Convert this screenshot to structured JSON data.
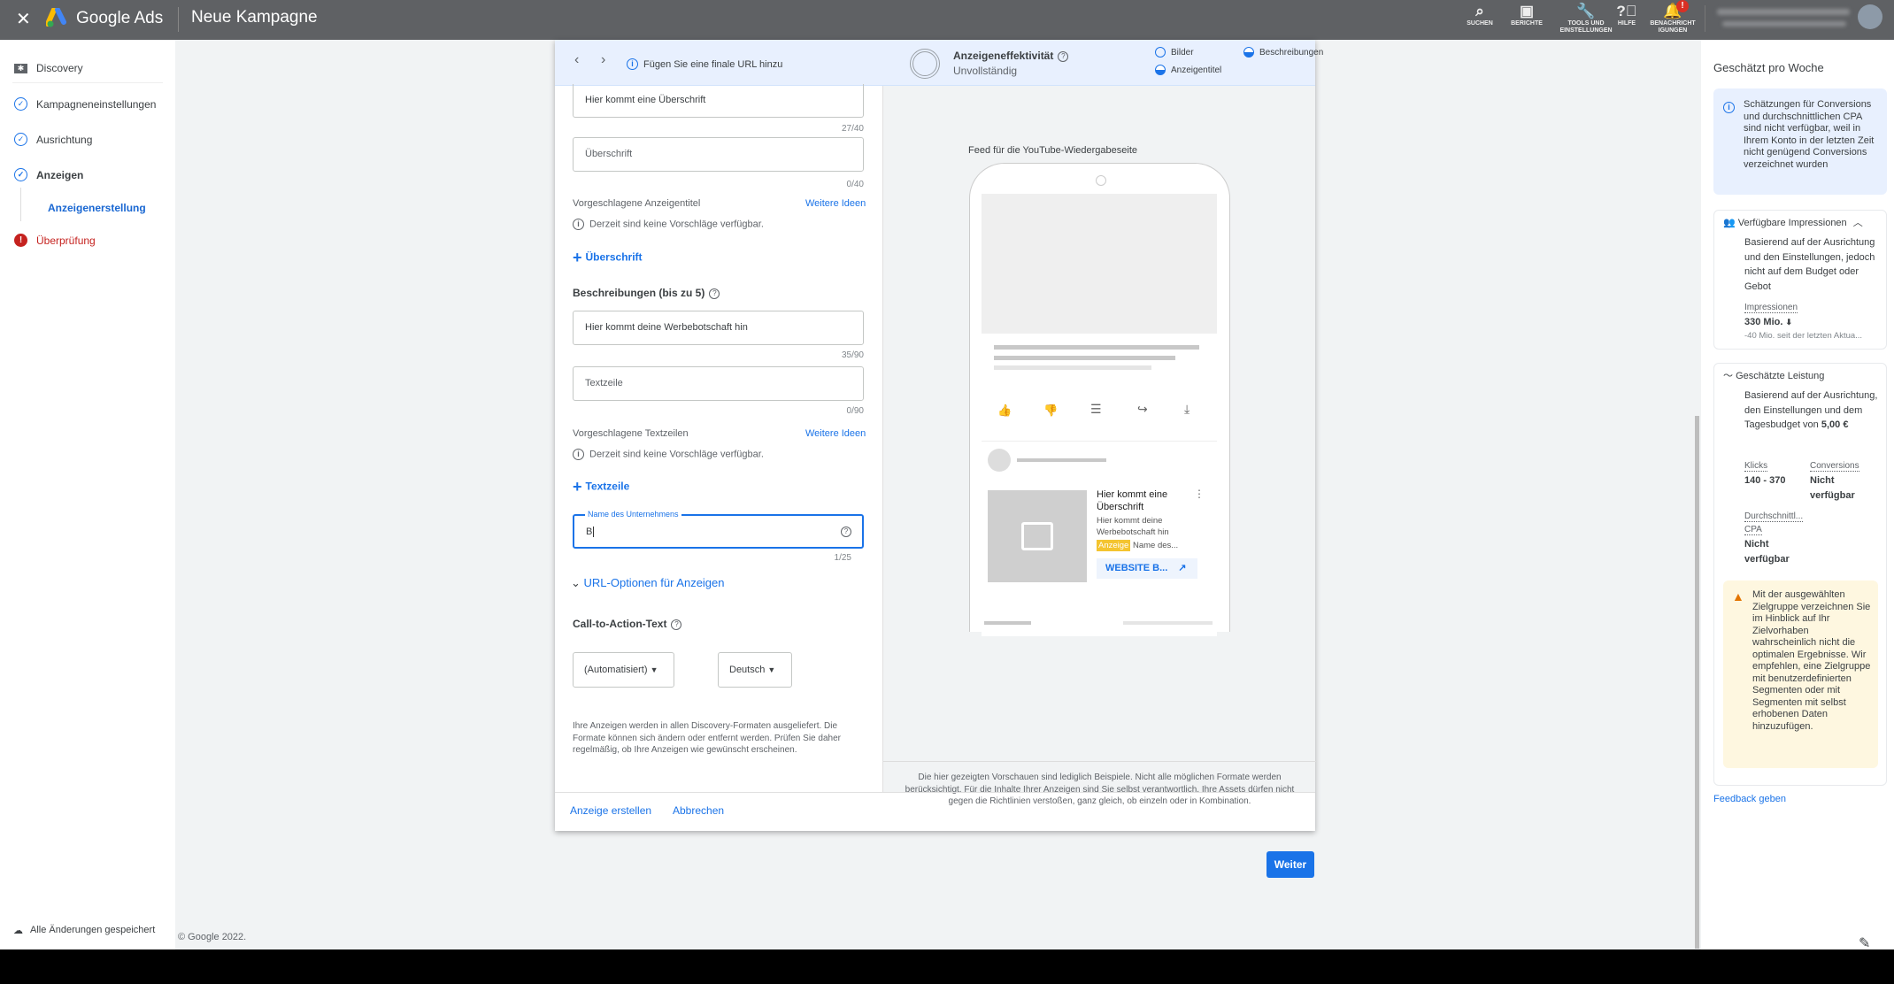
{
  "topbar": {
    "close_icon": "close-icon",
    "product": "Google Ads",
    "title": "Neue Kampagne",
    "actions": [
      {
        "icon": "search-icon",
        "label": "SUCHEN"
      },
      {
        "icon": "reports-icon",
        "label": "BERICHTE"
      },
      {
        "icon": "wrench-icon",
        "label": "TOOLS UND EINSTELLUNGEN"
      },
      {
        "icon": "help-icon",
        "label": "HILFE"
      },
      {
        "icon": "bell-icon",
        "label": "BENACHRICHT IGUNGEN",
        "badge": "!"
      }
    ]
  },
  "sidebar": {
    "campaign_type": "Discovery",
    "items": [
      {
        "label": "Kampagneneinstellungen",
        "state": "done"
      },
      {
        "label": "Ausrichtung",
        "state": "done"
      },
      {
        "label": "Anzeigen",
        "state": "done"
      },
      {
        "label": "Anzeigenerstellung",
        "state": "active"
      },
      {
        "label": "Überprüfung",
        "state": "error"
      }
    ],
    "saved": "Alle Änderungen gespeichert"
  },
  "footer": {
    "copyright": "© Google 2022."
  },
  "dialog": {
    "header": {
      "url_hint": "Fügen Sie eine finale URL hinzu",
      "effectiveness_label": "Anzeigeneffektivität",
      "effectiveness_value": "Unvollständig",
      "assets": [
        "Bilder",
        "Beschreibungen",
        "Anzeigentitel"
      ]
    },
    "headlines": [
      {
        "value": "Hier kommt eine Überschrift",
        "counter": "27/40"
      },
      {
        "placeholder": "Überschrift",
        "counter": "0/40"
      }
    ],
    "suggested_headlines": {
      "label": "Vorgeschlagene Anzeigentitel",
      "more": "Weitere Ideen",
      "empty": "Derzeit sind keine Vorschläge verfügbar."
    },
    "add_headline": "Überschrift",
    "descriptions_title": "Beschreibungen (bis zu 5)",
    "descriptions": [
      {
        "value": "Hier kommt deine Werbebotschaft hin",
        "counter": "35/90"
      },
      {
        "placeholder": "Textzeile",
        "counter": "0/90"
      }
    ],
    "suggested_descriptions": {
      "label": "Vorgeschlagene Textzeilen",
      "more": "Weitere Ideen",
      "empty": "Derzeit sind keine Vorschläge verfügbar."
    },
    "add_description": "Textzeile",
    "business_name": {
      "label": "Name des Unternehmens",
      "value": "B",
      "counter": "1/25"
    },
    "url_options": "URL-Optionen für Anzeigen",
    "cta": {
      "label": "Call-to-Action-Text",
      "value": "(Automatisiert)",
      "language": "Deutsch"
    },
    "formats_note": "Ihre Anzeigen werden in allen Discovery-Formaten ausgeliefert. Die Formate können sich ändern oder entfernt werden. Prüfen Sie daher regelmäßig, ob Ihre Anzeigen wie gewünscht erscheinen.",
    "preview": {
      "title": "Feed für die YouTube-Wiedergabeseite",
      "ad_headline": "Hier kommt eine Überschrift",
      "ad_description": "Hier kommt deine Werbebotschaft hin",
      "ad_badge": "Anzeige",
      "ad_business": "Name des...",
      "ad_cta": "WEBSITE B...",
      "disclaimer": "Die hier gezeigten Vorschauen sind lediglich Beispiele. Nicht alle möglichen Formate werden berücksichtigt. Für die Inhalte Ihrer Anzeigen sind Sie selbst verantwortlich. Ihre Assets dürfen nicht gegen die Richtlinien verstoßen, ganz gleich, ob einzeln oder in Kombination."
    },
    "create": "Anzeige erstellen",
    "cancel": "Abbrechen"
  },
  "next_button": "Weiter",
  "right": {
    "title": "Geschätzt pro Woche",
    "notice": "Schätzungen für Conversions und durchschnittlichen CPA sind nicht verfügbar, weil in Ihrem Konto in der letzten Zeit nicht genügend Conversions verzeichnet wurden",
    "impressions": {
      "title": "Verfügbare Impressionen",
      "desc": "Basierend auf der Ausrichtung und den Einstellungen, jedoch nicht auf dem Budget oder Gebot",
      "metric": "Impressionen",
      "value": "330 Mio.",
      "change": "-40 Mio. seit der letzten Aktua..."
    },
    "performance": {
      "title": "Geschätzte Leistung",
      "desc": "Basierend auf der Ausrichtung, den Einstellungen und dem Tagesbudget von",
      "budget": "5,00 €",
      "clicks_label": "Klicks",
      "clicks": "140 - 370",
      "conv_label": "Conversions",
      "conv": "Nicht verfügbar",
      "cpa_label": "Durchschnittl... CPA",
      "cpa": "Nicht verfügbar"
    },
    "warning": "Mit der ausgewählten Zielgruppe verzeichnen Sie im Hinblick auf Ihr Zielvorhaben wahrscheinlich nicht die optimalen Ergebnisse. Wir empfehlen, eine Zielgruppe mit benutzerdefinierten Segmenten oder mit Segmenten mit selbst erhobenen Daten hinzuzufügen.",
    "feedback": "Feedback geben"
  },
  "colors": {
    "accent": "#1a73e8",
    "topbar": "#5f6164",
    "error": "#c5221f",
    "warning_bg": "#fef7e0",
    "badge": "#f9ab00"
  }
}
